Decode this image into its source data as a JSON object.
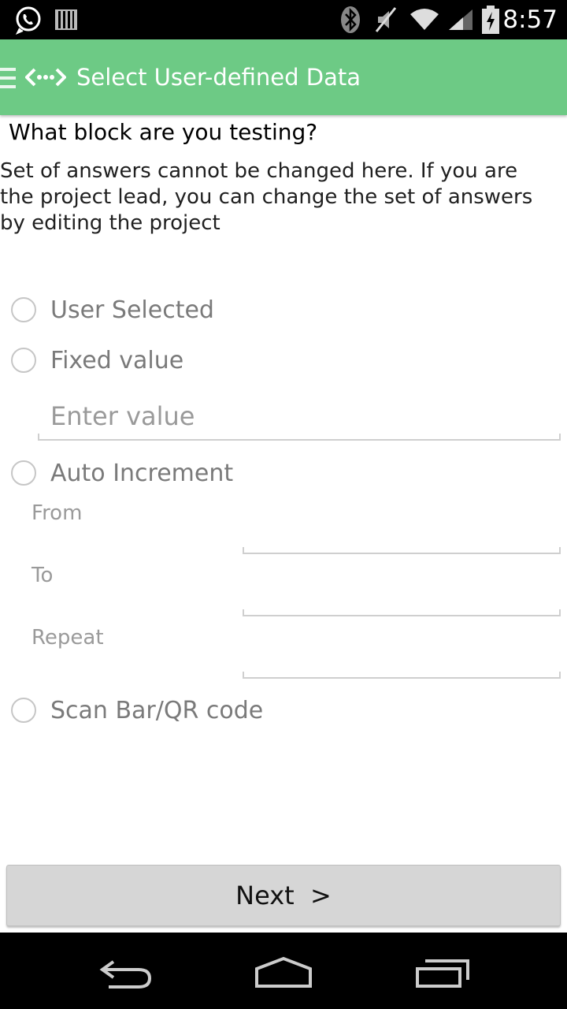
{
  "status_bar": {
    "time": "8:57",
    "icons": [
      "whatsapp-icon",
      "barcode-icon",
      "bluetooth-icon",
      "mute-icon",
      "wifi-icon",
      "signal-icon",
      "battery-charging-icon"
    ]
  },
  "action_bar": {
    "title": "Select User-defined Data",
    "background_color": "#6dca85"
  },
  "question": "What block are you testing?",
  "note": "Set of answers cannot be changed here. If you are the project lead, you can change the set of answers by editing the project",
  "options": {
    "user_selected": "User Selected",
    "fixed_value": "Fixed value",
    "fixed_value_placeholder": "Enter value",
    "auto_increment": "Auto Increment",
    "from_label": "From",
    "to_label": "To",
    "repeat_label": "Repeat",
    "scan_code": "Scan Bar/QR code"
  },
  "next_button": "Next  >",
  "nav_bar": {
    "icons": [
      "back-icon",
      "home-icon",
      "recent-apps-icon"
    ]
  }
}
